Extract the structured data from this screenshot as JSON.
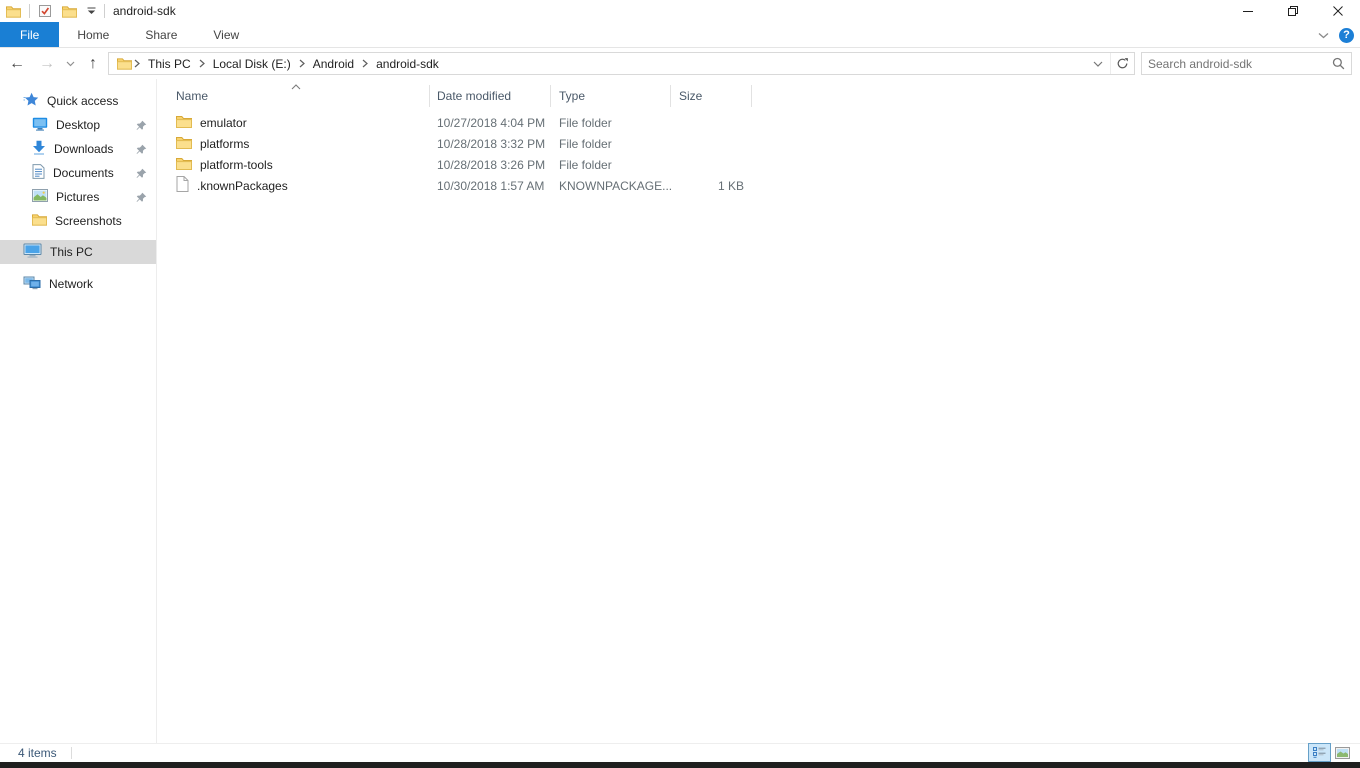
{
  "window": {
    "title": "android-sdk"
  },
  "ribbon": {
    "tabs": [
      {
        "label": "File",
        "active": true
      },
      {
        "label": "Home",
        "active": false
      },
      {
        "label": "Share",
        "active": false
      },
      {
        "label": "View",
        "active": false
      }
    ]
  },
  "address": {
    "breadcrumb": [
      "This PC",
      "Local Disk (E:)",
      "Android",
      "android-sdk"
    ]
  },
  "search": {
    "placeholder": "Search android-sdk"
  },
  "sidebar": {
    "items": [
      {
        "label": "Quick access",
        "icon": "quick-access-star",
        "pinned": false,
        "selected": false
      },
      {
        "label": "Desktop",
        "icon": "desktop",
        "pinned": true,
        "selected": false
      },
      {
        "label": "Downloads",
        "icon": "downloads",
        "pinned": true,
        "selected": false
      },
      {
        "label": "Documents",
        "icon": "documents",
        "pinned": true,
        "selected": false
      },
      {
        "label": "Pictures",
        "icon": "pictures",
        "pinned": true,
        "selected": false
      },
      {
        "label": "Screenshots",
        "icon": "folder",
        "pinned": false,
        "selected": false
      },
      {
        "label": "This PC",
        "icon": "computer",
        "pinned": false,
        "selected": true
      },
      {
        "label": "Network",
        "icon": "network",
        "pinned": false,
        "selected": false
      }
    ]
  },
  "filelist": {
    "columns": [
      "Name",
      "Date modified",
      "Type",
      "Size"
    ],
    "sort": {
      "column": "Name",
      "direction": "ascending"
    },
    "rows": [
      {
        "name": "emulator",
        "icon": "folder",
        "date_modified": "10/27/2018 4:04 PM",
        "type": "File folder",
        "size": ""
      },
      {
        "name": "platforms",
        "icon": "folder",
        "date_modified": "10/28/2018 3:32 PM",
        "type": "File folder",
        "size": ""
      },
      {
        "name": "platform-tools",
        "icon": "folder",
        "date_modified": "10/28/2018 3:26 PM",
        "type": "File folder",
        "size": ""
      },
      {
        "name": ".knownPackages",
        "icon": "file",
        "date_modified": "10/30/2018 1:57 AM",
        "type": "KNOWNPACKAGE...",
        "size": "1 KB"
      }
    ]
  },
  "statusbar": {
    "item_count": "4 items"
  },
  "icons": {
    "quick_access_toolbar": [
      "app-folder-icon",
      "properties-checkbox-icon",
      "new-folder-icon",
      "qat-dropdown-icon"
    ],
    "window_controls": [
      "minimize-icon",
      "restore-icon",
      "close-icon"
    ],
    "navigation": [
      "back-arrow-icon",
      "forward-arrow-icon",
      "recent-locations-chevron-icon",
      "up-arrow-icon",
      "address-folder-icon",
      "address-dropdown-icon",
      "refresh-icon",
      "search-icon"
    ],
    "ribbon": [
      "ribbon-expand-chevron-icon",
      "help-icon"
    ],
    "status": [
      "details-view-icon",
      "thumbnails-view-icon"
    ]
  },
  "colors": {
    "accent_blue": "#1a7fd4",
    "selection_gray": "#d9d9d9",
    "folder_yellow": "#f7d26e",
    "taskbar_dark": "#1f1f1f"
  }
}
